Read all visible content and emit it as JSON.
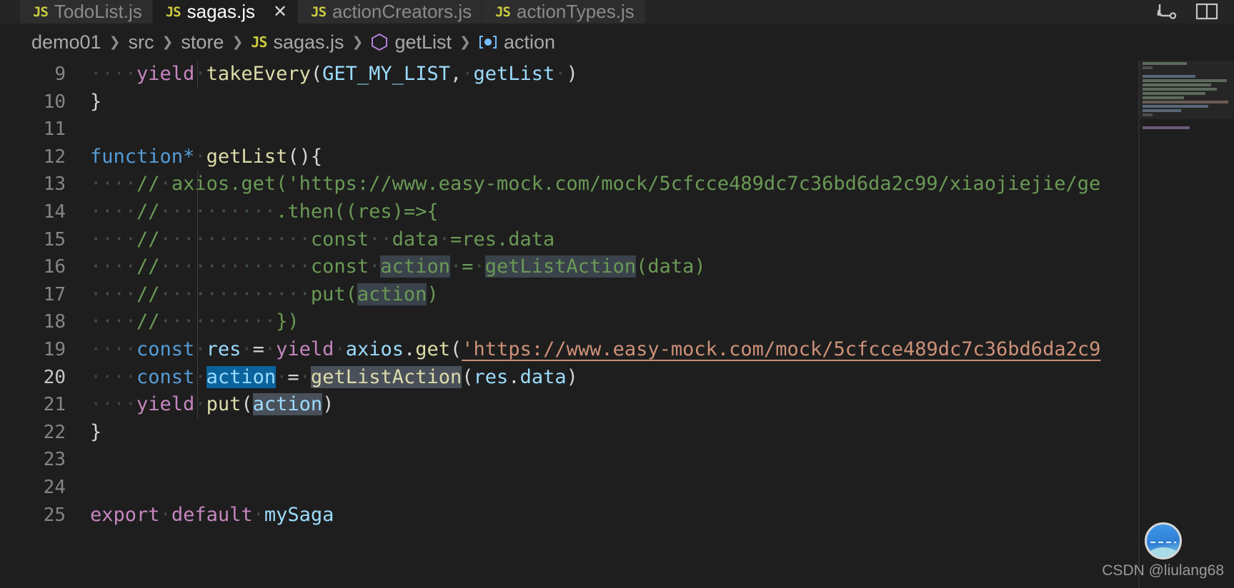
{
  "window": {
    "theme": "vscode-dark",
    "colors": {
      "background": "#1e1e1e",
      "tab_inactive": "#2d2d2d",
      "tab_active": "#1e1e1e",
      "tabbar": "#252526",
      "comment": "#6a9955",
      "string": "#ce9178",
      "keyword": "#c586c0",
      "keyword_blue": "#569cd6",
      "function": "#dcdcaa",
      "variable": "#9cdcfe",
      "selection": "#0a639d",
      "occurrence": "#4a5059",
      "line_number": "#858585"
    }
  },
  "tabs": [
    {
      "label": "TodoList.js",
      "icon": "js-file-icon",
      "active": false,
      "closable": false
    },
    {
      "label": "sagas.js",
      "icon": "js-file-icon",
      "active": true,
      "closable": true,
      "close_label": "✕"
    },
    {
      "label": "actionCreators.js",
      "icon": "js-file-icon",
      "active": false,
      "closable": false
    },
    {
      "label": "actionTypes.js",
      "icon": "js-file-icon",
      "active": false,
      "closable": false
    }
  ],
  "tab_actions": [
    {
      "name": "run-or-debug-icon",
      "label": ""
    },
    {
      "name": "split-editor-icon",
      "label": ""
    }
  ],
  "breadcrumbs": [
    {
      "label": "demo01",
      "icon": null
    },
    {
      "label": "src",
      "icon": null
    },
    {
      "label": "store",
      "icon": null
    },
    {
      "label": "sagas.js",
      "icon": "js-file-icon"
    },
    {
      "label": "getList",
      "icon": "symbol-method-icon"
    },
    {
      "label": "action",
      "icon": "symbol-variable-icon"
    }
  ],
  "breadcrumb_separator": "❯",
  "editor": {
    "file": "sagas.js",
    "language": "JavaScript",
    "first_visible_line": 9,
    "cursor_line": 20,
    "lines": [
      {
        "n": 9,
        "text": "    yield takeEvery(GET_MY_LIST, getList )"
      },
      {
        "n": 10,
        "text": "}"
      },
      {
        "n": 11,
        "text": ""
      },
      {
        "n": 12,
        "text": "function* getList(){"
      },
      {
        "n": 13,
        "text": "    // axios.get('https://www.easy-mock.com/mock/5cfcce489dc7c36bd6da2c99/xiaojiejie/ge"
      },
      {
        "n": 14,
        "text": "    //          .then((res)=>{"
      },
      {
        "n": 15,
        "text": "    //             const  data =res.data"
      },
      {
        "n": 16,
        "text": "    //             const action = getListAction(data)"
      },
      {
        "n": 17,
        "text": "    //             put(action)"
      },
      {
        "n": 18,
        "text": "    //          })"
      },
      {
        "n": 19,
        "text": "    const res = yield axios.get('https://www.easy-mock.com/mock/5cfcce489dc7c36bd6da2c9"
      },
      {
        "n": 20,
        "text": "    const action = getListAction(res.data)"
      },
      {
        "n": 21,
        "text": "    yield put(action)"
      },
      {
        "n": 22,
        "text": "}"
      },
      {
        "n": 23,
        "text": ""
      },
      {
        "n": 24,
        "text": ""
      },
      {
        "n": 25,
        "text": "export default mySaga"
      }
    ],
    "url_line13": "https://www.easy-mock.com/mock/5cfcce489dc7c36bd6da2c99/xiaojiejie/ge",
    "url_line19": "https://www.easy-mock.com/mock/5cfcce489dc7c36bd6da2c9",
    "selected_word": "action",
    "occurrence_word": "getListAction"
  },
  "watermark": {
    "text": "CSDN @liulang68",
    "avatar": "user-avatar"
  }
}
